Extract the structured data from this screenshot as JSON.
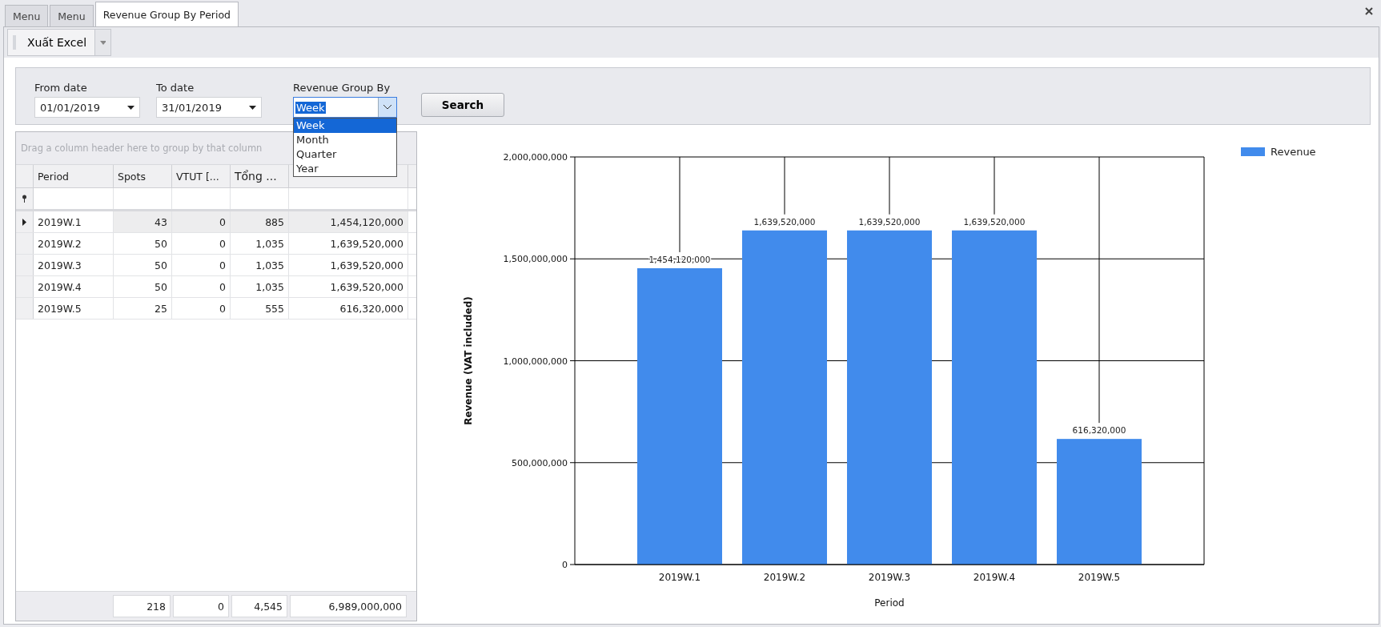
{
  "tabs": [
    {
      "label": "Menu",
      "selected": false
    },
    {
      "label": "Menu",
      "selected": false
    },
    {
      "label": "Revenue Group By Period",
      "selected": true
    }
  ],
  "toolbar": {
    "export_button": "Xuất Excel"
  },
  "filters": {
    "from_date": {
      "label": "From date",
      "value": "01/01/2019"
    },
    "to_date": {
      "label": "To date",
      "value": "31/01/2019"
    },
    "group_by": {
      "label": "Revenue Group By",
      "value": "Week",
      "expanded": true,
      "options": [
        {
          "label": "Week",
          "selected": true
        },
        {
          "label": "Month",
          "selected": false
        },
        {
          "label": "Quarter",
          "selected": false
        },
        {
          "label": "Year",
          "selected": false
        }
      ]
    },
    "search_button": "Search"
  },
  "grid": {
    "group_panel_hint": "Drag a column header here to group by that column",
    "columns": [
      "Period",
      "Spots",
      "VTUT [...",
      "Tổng ..."
    ],
    "rows": [
      {
        "period": "2019W.1",
        "spots": "43",
        "vtut": "0",
        "tong": "885",
        "revenue": "1,454,120,000",
        "selected": true
      },
      {
        "period": "2019W.2",
        "spots": "50",
        "vtut": "0",
        "tong": "1,035",
        "revenue": "1,639,520,000",
        "selected": false
      },
      {
        "period": "2019W.3",
        "spots": "50",
        "vtut": "0",
        "tong": "1,035",
        "revenue": "1,639,520,000",
        "selected": false
      },
      {
        "period": "2019W.4",
        "spots": "50",
        "vtut": "0",
        "tong": "1,035",
        "revenue": "1,639,520,000",
        "selected": false
      },
      {
        "period": "2019W.5",
        "spots": "25",
        "vtut": "0",
        "tong": "555",
        "revenue": "616,320,000",
        "selected": false
      }
    ],
    "totals": {
      "spots": "218",
      "vtut": "0",
      "tong": "4,545",
      "revenue": "6,989,000,000"
    }
  },
  "chart": {
    "chart_data": {
      "type": "bar",
      "xlabel": "Period",
      "ylabel": "Revenue (VAT included)",
      "categories": [
        "2019W.1",
        "2019W.2",
        "2019W.3",
        "2019W.4",
        "2019W.5"
      ],
      "series": [
        {
          "name": "Revenue",
          "color": "#418bec",
          "values": [
            1454120000,
            1639520000,
            1639520000,
            1639520000,
            616320000
          ]
        }
      ],
      "ylim": [
        0,
        2000000000
      ],
      "yticks": [
        {
          "value": 0,
          "label": "0"
        },
        {
          "value": 500000000,
          "label": "500,000,000"
        },
        {
          "value": 1000000000,
          "label": "1,000,000,000"
        },
        {
          "value": 1500000000,
          "label": "1,500,000,000"
        },
        {
          "value": 2000000000,
          "label": "2,000,000,000"
        }
      ],
      "grid": true,
      "data_labels": "value_labels",
      "value_labels": [
        "1,454,120,000",
        "1,639,520,000",
        "1,639,520,000",
        "1,639,520,000",
        "616,320,000"
      ]
    }
  }
}
